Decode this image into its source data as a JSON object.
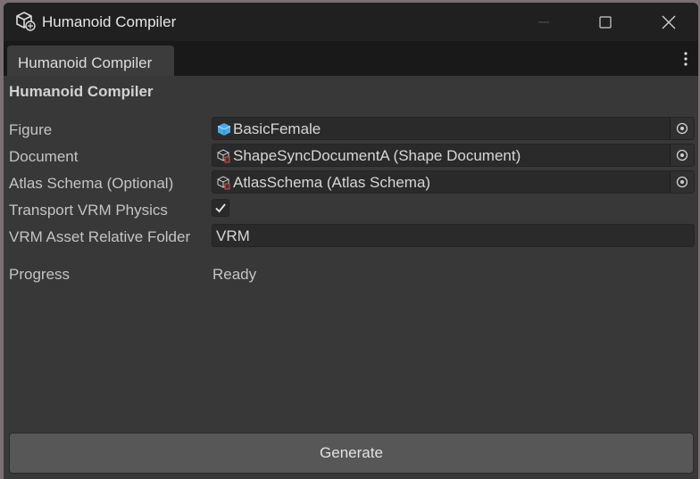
{
  "window": {
    "title": "Humanoid Compiler",
    "icon": "unity-cube-icon"
  },
  "tab": {
    "label": "Humanoid Compiler"
  },
  "panel": {
    "title": "Humanoid Compiler"
  },
  "fields": {
    "figure": {
      "label": "Figure",
      "value": "BasicFemale",
      "icon": "prefab-cube-icon"
    },
    "document": {
      "label": "Document",
      "value": "ShapeSyncDocumentA (Shape Document)",
      "icon": "scriptable-object-icon"
    },
    "atlas": {
      "label": "Atlas Schema (Optional)",
      "value": "AtlasSchema (Atlas Schema)",
      "icon": "scriptable-object-icon"
    },
    "transport": {
      "label": "Transport VRM Physics",
      "checked": true
    },
    "folder": {
      "label": "VRM Asset Relative Folder",
      "value": "VRM"
    },
    "progress": {
      "label": "Progress",
      "value": "Ready"
    }
  },
  "actions": {
    "generate_label": "Generate"
  },
  "colors": {
    "background": "#383838",
    "titlebar": "#202020",
    "field": "#2a2a2a",
    "button": "#575757",
    "prefab_blue": "#4aa8e8"
  }
}
